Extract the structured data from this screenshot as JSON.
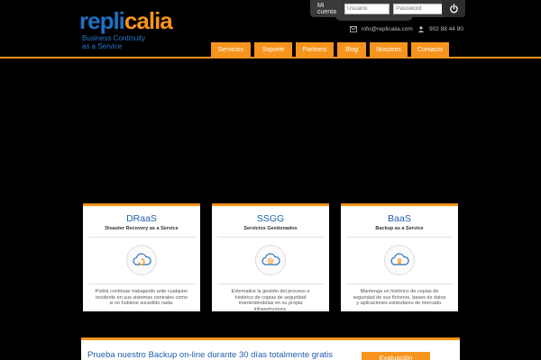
{
  "logo": {
    "part1": "repli",
    "part2": "calia",
    "tagline_line1": "Business Continuity",
    "tagline_line2": "as a Service"
  },
  "login": {
    "label": "Mi cuenta",
    "user_placeholder": "Usuario",
    "password_placeholder": "Password"
  },
  "contact": {
    "email": "info@replicalia.com",
    "phone": "902 88 44 80"
  },
  "nav": {
    "items": [
      "Servicios",
      "Soporte",
      "Partners",
      "Blog",
      "Nosotros",
      "Contacto"
    ]
  },
  "cards": [
    {
      "title": "DRaaS",
      "subtitle": "Disaster Recovery as a Service",
      "description": "Podrá continuar trabajando ante cualquier incidente en sus sistemas centrales como si no hubiese sucedido nada."
    },
    {
      "title": "SSGG",
      "subtitle": "Servicios Gestionados",
      "description": "Externalice la gestión del proceso e histórico de copias de seguridad manteniéndolas en su propia infraestructura."
    },
    {
      "title": "BaaS",
      "subtitle": "Backup as a Service",
      "description": "Mantenga un histórico de copias de seguridad de sus ficheros, bases de datos y aplicaciones estándares de mercado."
    }
  ],
  "banner": {
    "text": "Prueba nuestro Backup on-line durante 30 días totalmente gratis",
    "button": "Evaluación"
  },
  "colors": {
    "brand_blue": "#1f6fc4",
    "accent_orange": "#f7941d",
    "background": "#000000"
  }
}
